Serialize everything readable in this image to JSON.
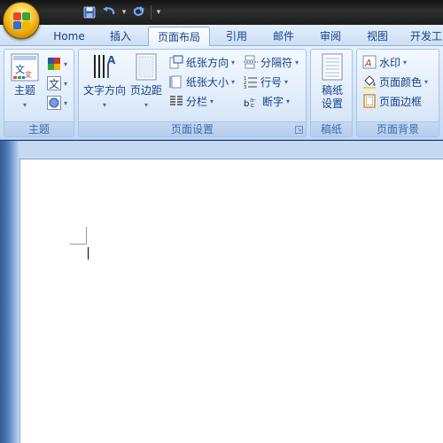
{
  "quick_access": {
    "items": [
      "save-icon",
      "undo-icon",
      "redo-icon"
    ]
  },
  "tabs": [
    {
      "label": "Home",
      "active": false
    },
    {
      "label": "插入",
      "active": false
    },
    {
      "label": "页面布局",
      "active": true
    },
    {
      "label": "引用",
      "active": false
    },
    {
      "label": "邮件",
      "active": false
    },
    {
      "label": "审阅",
      "active": false
    },
    {
      "label": "视图",
      "active": false
    },
    {
      "label": "开发工",
      "active": false
    }
  ],
  "ribbon": {
    "theme_group": {
      "label": "主题",
      "theme_button": "主题"
    },
    "page_setup_group": {
      "label": "页面设置",
      "text_direction": "文字方向",
      "margins": "页边距",
      "orientation": "纸张方向",
      "size": "纸张大小",
      "columns": "分栏",
      "breaks": "分隔符",
      "line_numbers": "行号",
      "hyphenation": "断字"
    },
    "paper_group": {
      "label": "稿纸",
      "paper_settings_line1": "稿纸",
      "paper_settings_line2": "设置"
    },
    "background_group": {
      "label": "页面背景",
      "watermark": "水印",
      "page_color": "页面颜色",
      "page_borders": "页面边框"
    }
  },
  "colors": {
    "titlebar": "#1c1c1c",
    "ribbon_bg": "#d4e4f7",
    "text": "#15428b",
    "document_bg": "#ffffff"
  }
}
